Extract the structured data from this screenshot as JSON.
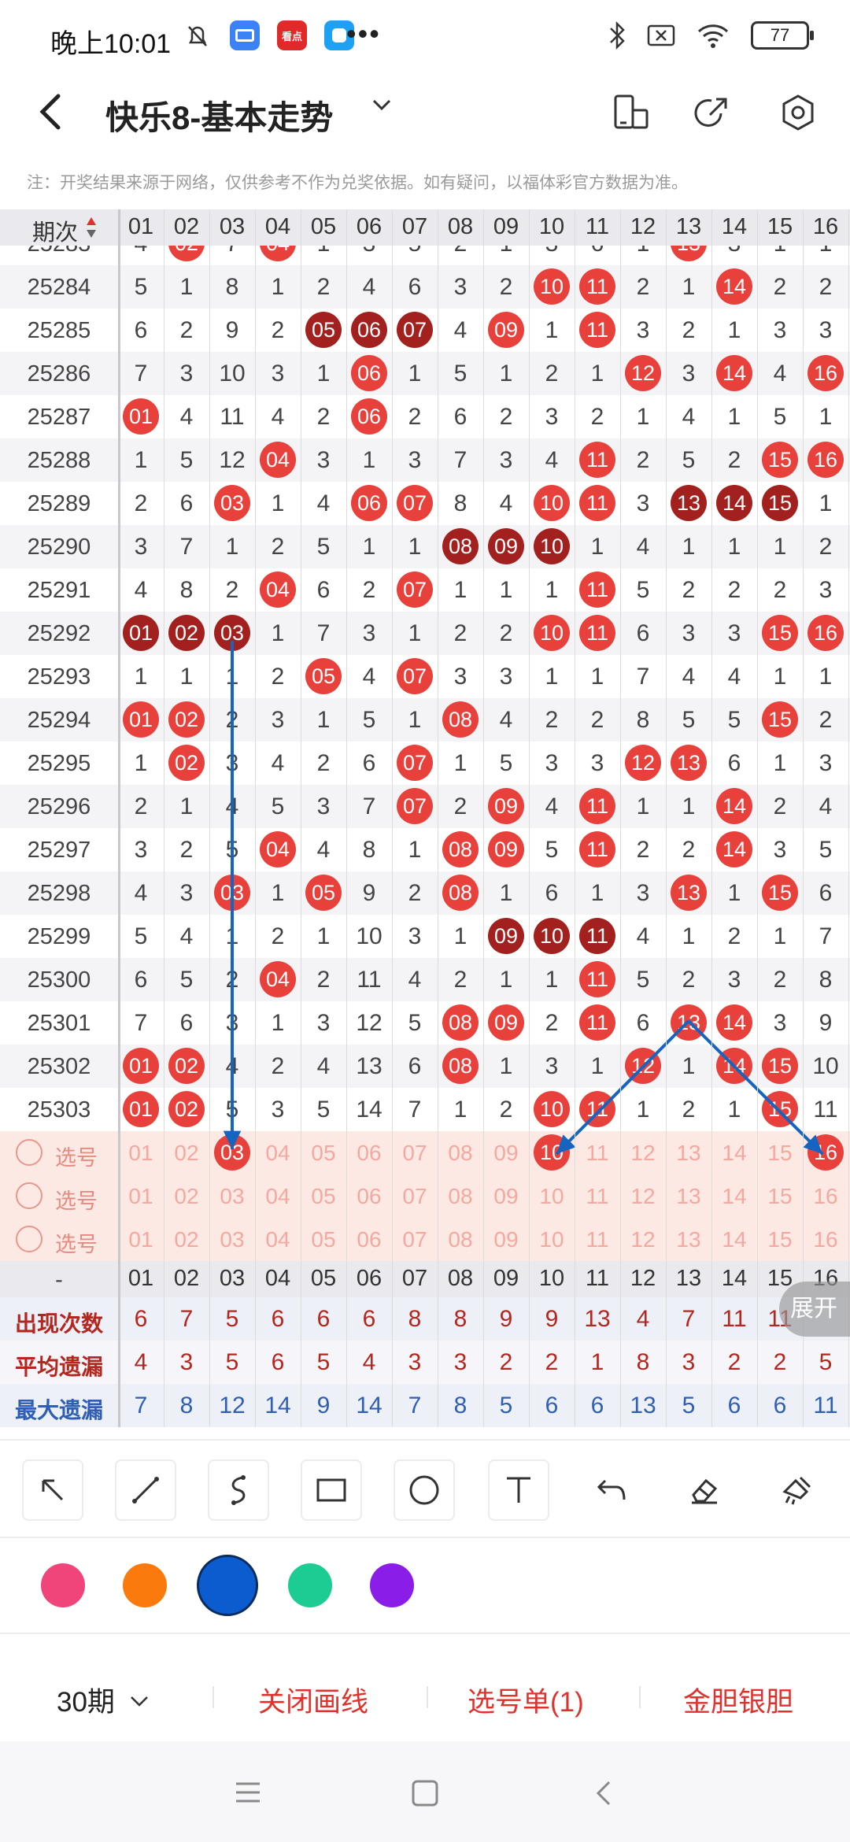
{
  "status_bar": {
    "time": "晚上10:01",
    "battery": "77",
    "more": "•••",
    "app_badge_text": "看点"
  },
  "header": {
    "title": "快乐8-基本走势",
    "back_icon": "chevron-left-icon",
    "icons": [
      "phone-layout-icon",
      "share-icon",
      "settings-icon"
    ]
  },
  "notice": "注：开奖结果来源于网络，仅供参考不作为兑奖依据。如有疑问，以福体彩官方数据为准。",
  "table": {
    "issue_header": "期次",
    "columns": [
      "01",
      "02",
      "03",
      "04",
      "05",
      "06",
      "07",
      "08",
      "09",
      "10",
      "11",
      "12",
      "13",
      "14",
      "15",
      "16"
    ],
    "rows": [
      {
        "issue": "25283",
        "cells": [
          "4",
          "02",
          "7",
          "04",
          "1",
          "3",
          "5",
          "2",
          "1",
          "3",
          "6",
          "1",
          "13",
          "3",
          "1",
          "1"
        ]
      },
      {
        "issue": "25284",
        "cells": [
          "5",
          "1",
          "8",
          "1",
          "2",
          "4",
          "6",
          "3",
          "2",
          "10",
          "11",
          "2",
          "1",
          "14",
          "2",
          "2"
        ]
      },
      {
        "issue": "25285",
        "cells": [
          "6",
          "2",
          "9",
          "2",
          "05",
          "06",
          "07",
          "4",
          "09",
          "1",
          "11",
          "3",
          "2",
          "1",
          "3",
          "3"
        ]
      },
      {
        "issue": "25286",
        "cells": [
          "7",
          "3",
          "10",
          "3",
          "1",
          "06",
          "1",
          "5",
          "1",
          "2",
          "1",
          "12",
          "3",
          "14",
          "4",
          "16"
        ]
      },
      {
        "issue": "25287",
        "cells": [
          "01",
          "4",
          "11",
          "4",
          "2",
          "06",
          "2",
          "6",
          "2",
          "3",
          "2",
          "1",
          "4",
          "1",
          "5",
          "1"
        ]
      },
      {
        "issue": "25288",
        "cells": [
          "1",
          "5",
          "12",
          "04",
          "3",
          "1",
          "3",
          "7",
          "3",
          "4",
          "11",
          "2",
          "5",
          "2",
          "15",
          "16"
        ]
      },
      {
        "issue": "25289",
        "cells": [
          "2",
          "6",
          "03",
          "1",
          "4",
          "06",
          "07",
          "8",
          "4",
          "10",
          "11",
          "3",
          "13",
          "14",
          "15",
          "1"
        ]
      },
      {
        "issue": "25290",
        "cells": [
          "3",
          "7",
          "1",
          "2",
          "5",
          "1",
          "1",
          "08",
          "09",
          "10",
          "1",
          "4",
          "1",
          "1",
          "1",
          "2"
        ]
      },
      {
        "issue": "25291",
        "cells": [
          "4",
          "8",
          "2",
          "04",
          "6",
          "2",
          "07",
          "1",
          "1",
          "1",
          "11",
          "5",
          "2",
          "2",
          "2",
          "3"
        ]
      },
      {
        "issue": "25292",
        "cells": [
          "01",
          "02",
          "03",
          "1",
          "7",
          "3",
          "1",
          "2",
          "2",
          "10",
          "11",
          "6",
          "3",
          "3",
          "15",
          "16"
        ]
      },
      {
        "issue": "25293",
        "cells": [
          "1",
          "1",
          "1",
          "2",
          "05",
          "4",
          "07",
          "3",
          "3",
          "1",
          "1",
          "7",
          "4",
          "4",
          "1",
          "1"
        ]
      },
      {
        "issue": "25294",
        "cells": [
          "01",
          "02",
          "2",
          "3",
          "1",
          "5",
          "1",
          "08",
          "4",
          "2",
          "2",
          "8",
          "5",
          "5",
          "15",
          "2"
        ]
      },
      {
        "issue": "25295",
        "cells": [
          "1",
          "02",
          "3",
          "4",
          "2",
          "6",
          "07",
          "1",
          "5",
          "3",
          "3",
          "12",
          "13",
          "6",
          "1",
          "3"
        ]
      },
      {
        "issue": "25296",
        "cells": [
          "2",
          "1",
          "4",
          "5",
          "3",
          "7",
          "07",
          "2",
          "09",
          "4",
          "11",
          "1",
          "1",
          "14",
          "2",
          "4"
        ]
      },
      {
        "issue": "25297",
        "cells": [
          "3",
          "2",
          "5",
          "04",
          "4",
          "8",
          "1",
          "08",
          "09",
          "5",
          "11",
          "2",
          "2",
          "14",
          "3",
          "5"
        ]
      },
      {
        "issue": "25298",
        "cells": [
          "4",
          "3",
          "03",
          "1",
          "05",
          "9",
          "2",
          "08",
          "1",
          "6",
          "1",
          "3",
          "13",
          "1",
          "15",
          "6"
        ]
      },
      {
        "issue": "25299",
        "cells": [
          "5",
          "4",
          "1",
          "2",
          "1",
          "10",
          "3",
          "1",
          "09",
          "10",
          "11",
          "4",
          "1",
          "2",
          "1",
          "7"
        ]
      },
      {
        "issue": "25300",
        "cells": [
          "6",
          "5",
          "2",
          "04",
          "2",
          "11",
          "4",
          "2",
          "1",
          "1",
          "11",
          "5",
          "2",
          "3",
          "2",
          "8"
        ]
      },
      {
        "issue": "25301",
        "cells": [
          "7",
          "6",
          "3",
          "1",
          "3",
          "12",
          "5",
          "08",
          "09",
          "2",
          "11",
          "6",
          "13",
          "14",
          "3",
          "9"
        ]
      },
      {
        "issue": "25302",
        "cells": [
          "01",
          "02",
          "4",
          "2",
          "4",
          "13",
          "6",
          "08",
          "1",
          "3",
          "1",
          "12",
          "1",
          "14",
          "15",
          "10"
        ]
      },
      {
        "issue": "25303",
        "cells": [
          "01",
          "02",
          "5",
          "3",
          "5",
          "14",
          "7",
          "1",
          "2",
          "10",
          "11",
          "1",
          "2",
          "1",
          "15",
          "11"
        ]
      }
    ],
    "dark_balls": [
      [
        2,
        4
      ],
      [
        2,
        5
      ],
      [
        2,
        6
      ],
      [
        6,
        12
      ],
      [
        6,
        13
      ],
      [
        6,
        14
      ],
      [
        7,
        7
      ],
      [
        7,
        8
      ],
      [
        7,
        9
      ],
      [
        9,
        0
      ],
      [
        9,
        1
      ],
      [
        9,
        2
      ],
      [
        16,
        8
      ],
      [
        16,
        9
      ],
      [
        16,
        10
      ]
    ],
    "select_rows": [
      {
        "label": "选号",
        "numbers": [
          "01",
          "02",
          "03",
          "04",
          "05",
          "06",
          "07",
          "08",
          "09",
          "10",
          "11",
          "12",
          "13",
          "14",
          "15",
          "16"
        ],
        "selected": [
          "03",
          "10",
          "16"
        ]
      },
      {
        "label": "选号",
        "numbers": [
          "01",
          "02",
          "03",
          "04",
          "05",
          "06",
          "07",
          "08",
          "09",
          "10",
          "11",
          "12",
          "13",
          "14",
          "15",
          "16"
        ],
        "selected": []
      },
      {
        "label": "选号",
        "numbers": [
          "01",
          "02",
          "03",
          "04",
          "05",
          "06",
          "07",
          "08",
          "09",
          "10",
          "11",
          "12",
          "13",
          "14",
          "15",
          "16"
        ],
        "selected": []
      }
    ],
    "footer_header_label": "-",
    "stats": [
      {
        "label": "出现次数",
        "color": "#b3271f",
        "values": [
          "6",
          "7",
          "5",
          "6",
          "6",
          "6",
          "8",
          "8",
          "9",
          "9",
          "13",
          "4",
          "7",
          "11",
          "11",
          ""
        ]
      },
      {
        "label": "平均遗漏",
        "color": "#b3271f",
        "values": [
          "4",
          "3",
          "5",
          "6",
          "5",
          "4",
          "3",
          "3",
          "2",
          "2",
          "1",
          "8",
          "3",
          "2",
          "2",
          "5"
        ]
      },
      {
        "label": "最大遗漏",
        "color": "#2f5fb3",
        "values": [
          "7",
          "8",
          "12",
          "14",
          "9",
          "14",
          "7",
          "8",
          "5",
          "6",
          "6",
          "13",
          "5",
          "6",
          "6",
          "11"
        ]
      }
    ],
    "expand_label": "展开"
  },
  "draw_tools": [
    "arrow-tool-icon",
    "line-tool-icon",
    "curve-tool-icon",
    "rectangle-tool-icon",
    "circle-tool-icon",
    "text-tool-icon",
    "undo-icon",
    "eraser-icon",
    "clear-icon"
  ],
  "colors": [
    "#f0457a",
    "#fb7a0e",
    "#0a5ccf",
    "#1ccc92",
    "#8b1de8"
  ],
  "selected_color": "#0a5ccf",
  "bottom_bar": {
    "period": "30期",
    "close_line": "关闭画线",
    "pick_list": "选号单(1)",
    "gold_silver": "金胆银胆"
  }
}
